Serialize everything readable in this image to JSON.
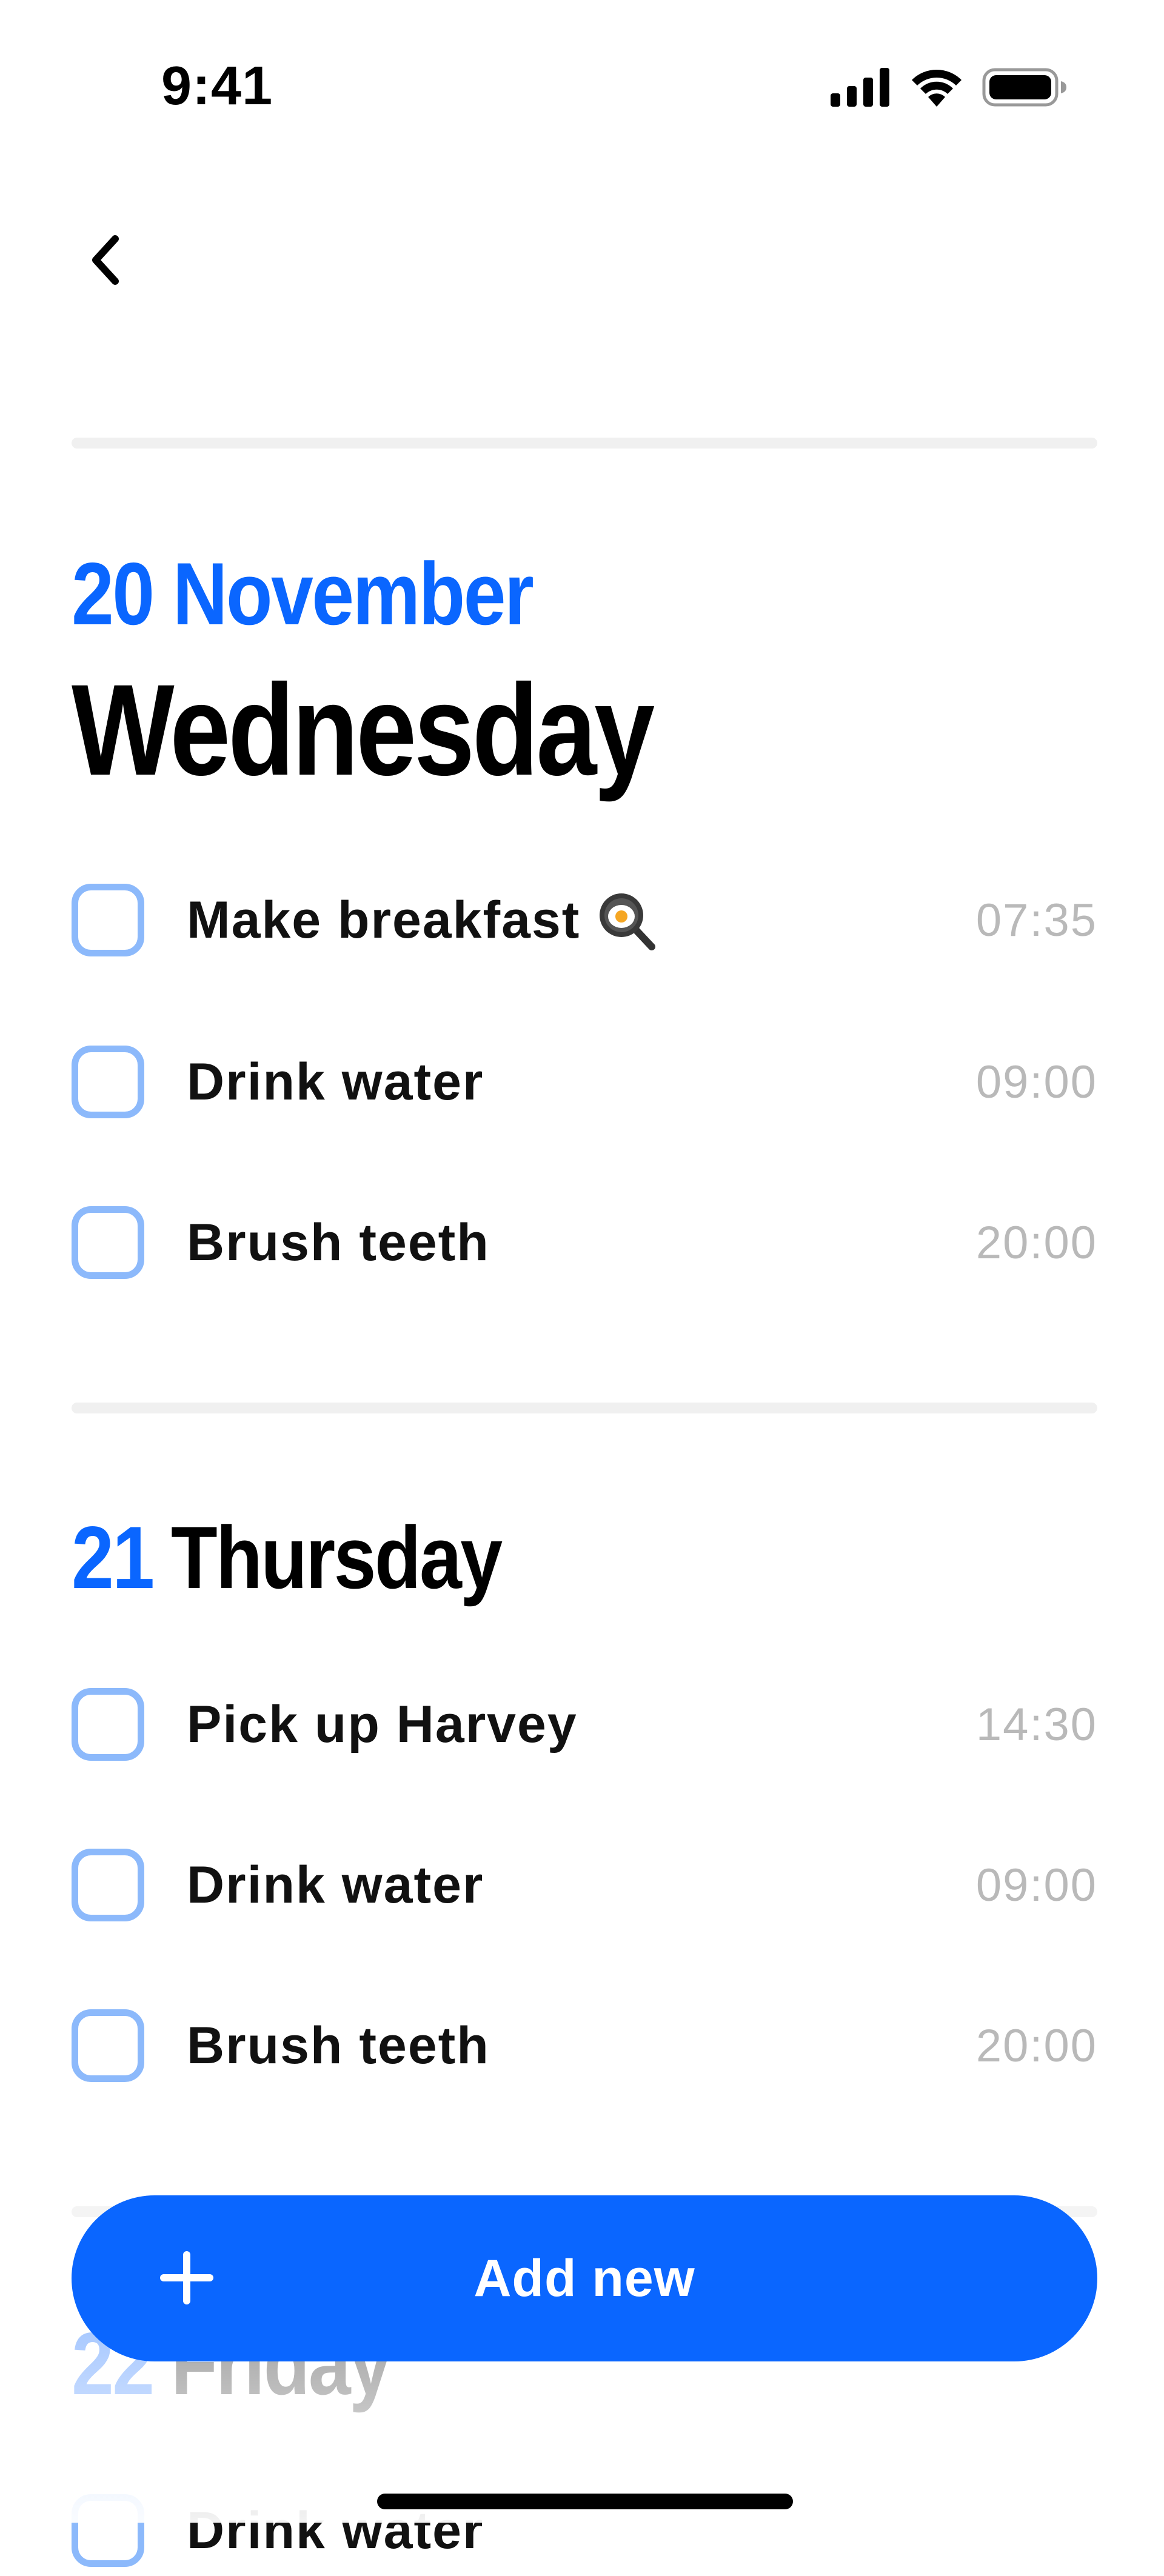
{
  "status_bar": {
    "time": "9:41",
    "icons": [
      "cellular-signal-icon",
      "wifi-icon",
      "battery-icon"
    ]
  },
  "navigation": {
    "back_icon": "chevron-left-icon"
  },
  "days": [
    {
      "date_label": "20 November",
      "day_label": "Wednesday",
      "tasks": [
        {
          "label": "Make breakfast",
          "emoji_icon": "frying-pan-egg-icon",
          "time": "07:35",
          "checked": false
        },
        {
          "label": "Drink water",
          "time": "09:00",
          "checked": false
        },
        {
          "label": "Brush teeth",
          "time": "20:00",
          "checked": false
        }
      ]
    },
    {
      "date_label": "21",
      "day_label": "Thursday",
      "tasks": [
        {
          "label": "Pick up Harvey",
          "time": "14:30",
          "checked": false
        },
        {
          "label": "Drink water",
          "time": "09:00",
          "checked": false
        },
        {
          "label": "Brush teeth",
          "time": "20:00",
          "checked": false
        }
      ]
    },
    {
      "date_label": "22",
      "day_label": "Friday",
      "tasks": [
        {
          "label": "Drink water",
          "checked": false
        }
      ]
    }
  ],
  "add_button": {
    "label": "Add new",
    "icon": "plus-icon"
  },
  "colors": {
    "accent": "#0a66ff",
    "checkbox_border": "#8cb9fb",
    "time_text": "#b9b9b9",
    "divider": "#f0f0f0"
  }
}
